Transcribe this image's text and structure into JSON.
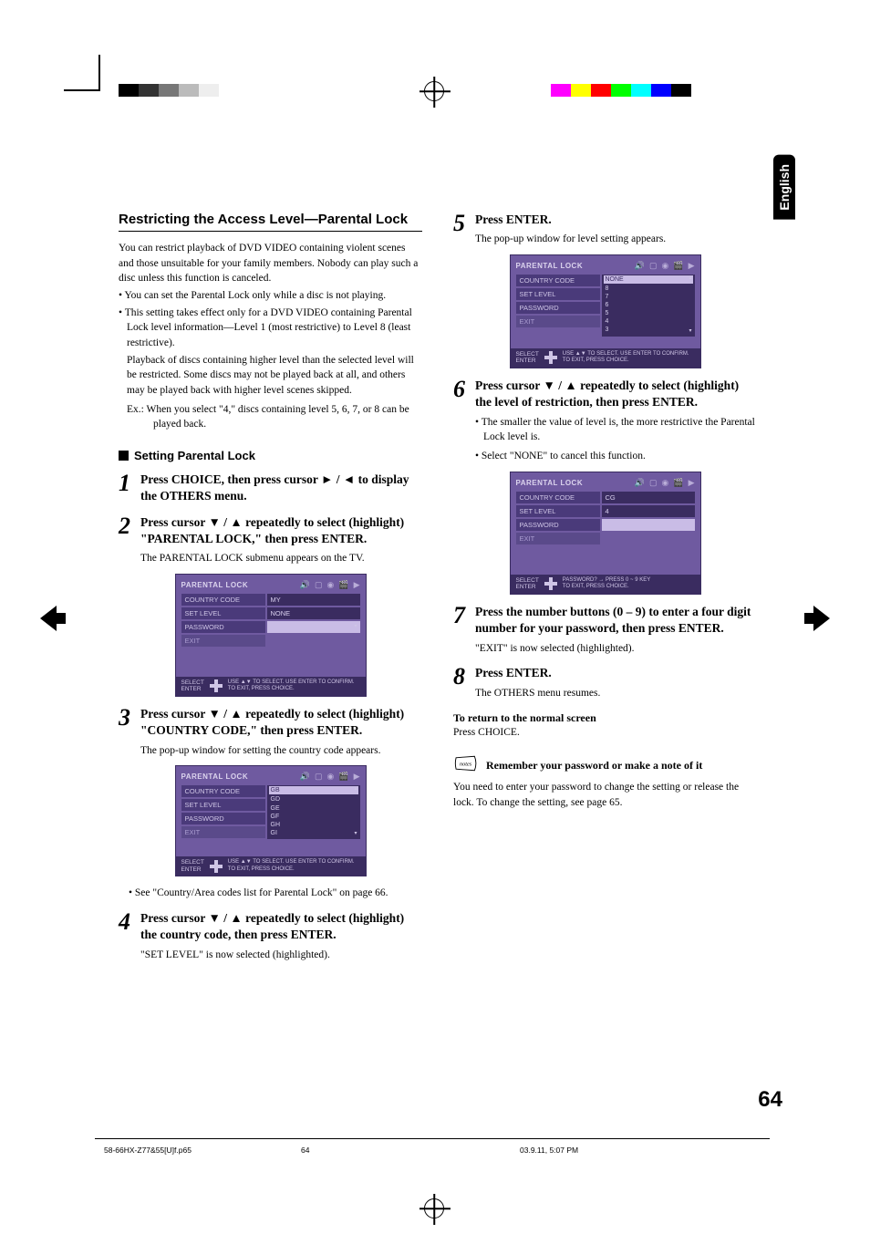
{
  "lang_tab": "English",
  "page_number": "64",
  "footer": {
    "file": "58-66HX-Z77&55[U]f.p65",
    "page": "64",
    "timestamp": "03.9.11, 5:07 PM"
  },
  "left": {
    "section_title": "Restricting the Access Level—Parental Lock",
    "intro": "You can restrict playback of DVD VIDEO containing violent scenes and those unsuitable for your family members. Nobody can play such a disc unless this function is canceled.",
    "b1": "• You can set the Parental Lock only while a disc is not playing.",
    "b2": "• This setting takes effect only for a DVD VIDEO containing Parental Lock level information—Level 1 (most restrictive) to Level 8 (least restrictive).",
    "b2a": "Playback of discs containing higher level than the selected level will be restricted. Some discs may not be played back at all, and others may be played back with higher level scenes skipped.",
    "ex": "Ex.: When you select \"4,\" discs containing level 5, 6, 7, or 8 can be played back.",
    "subhead": "Setting Parental Lock",
    "step1": "Press CHOICE, then press cursor ► / ◄ to display the OTHERS menu.",
    "step2": "Press cursor ▼ / ▲ repeatedly to select (highlight) \"PARENTAL LOCK,\" then press ENTER.",
    "step2_desc": "The PARENTAL LOCK submenu appears on the TV.",
    "step3": "Press cursor ▼ / ▲ repeatedly to select (highlight) \"COUNTRY CODE,\" then press ENTER.",
    "step3_desc": "The pop-up window for setting the country code appears.",
    "step3_note": "• See \"Country/Area codes list for Parental Lock\" on page 66.",
    "step4": "Press cursor ▼ / ▲ repeatedly to select (highlight) the country code, then press ENTER.",
    "step4_desc": "\"SET LEVEL\" is now selected (highlighted).",
    "osd1": {
      "title": "PARENTAL LOCK",
      "rows": {
        "country_code": "COUNTRY CODE",
        "country_code_val": "MY",
        "set_level": "SET LEVEL",
        "set_level_val": "NONE",
        "password": "PASSWORD",
        "exit": "EXIT"
      },
      "footer_lbl1": "SELECT",
      "footer_lbl2": "ENTER",
      "footer_hint": "USE ▲▼ TO SELECT.  USE ENTER TO CONFIRM.\nTO EXIT, PRESS CHOICE."
    },
    "osd2": {
      "title": "PARENTAL LOCK",
      "list": [
        "GB",
        "GD",
        "GE",
        "GF",
        "GH",
        "GI"
      ],
      "footer_lbl1": "SELECT",
      "footer_lbl2": "ENTER",
      "footer_hint": "USE ▲▼ TO SELECT.  USE ENTER TO CONFIRM.\nTO EXIT, PRESS CHOICE."
    }
  },
  "right": {
    "step5": "Press ENTER.",
    "step5_desc": "The pop-up window for level setting appears.",
    "osd3": {
      "title": "PARENTAL LOCK",
      "list": [
        "NONE",
        "8",
        "7",
        "6",
        "5",
        "4",
        "3"
      ],
      "footer_lbl1": "SELECT",
      "footer_lbl2": "ENTER",
      "footer_hint": "USE ▲▼ TO SELECT.  USE ENTER TO CONFIRM.\nTO EXIT, PRESS CHOICE."
    },
    "step6": "Press cursor ▼ / ▲ repeatedly to select (highlight) the level of restriction, then press ENTER.",
    "step6_b1": "• The smaller the value of level is, the more restrictive the Parental Lock level is.",
    "step6_b2": "• Select \"NONE\" to cancel this function.",
    "osd4": {
      "title": "PARENTAL LOCK",
      "country_code_val": "CG",
      "set_level_val": "4",
      "footer_lbl1": "SELECT",
      "footer_lbl2": "ENTER",
      "footer_hint": "PASSWORD? →  PRESS 0 ~ 9 KEY\nTO EXIT, PRESS CHOICE."
    },
    "step7": "Press the number buttons (0 – 9) to enter a four digit number for your password, then press ENTER.",
    "step7_desc": "\"EXIT\" is now selected (highlighted).",
    "step8": "Press ENTER.",
    "step8_desc": "The OTHERS menu resumes.",
    "return_head": "To return to the normal screen",
    "return_body": "Press CHOICE.",
    "notes_title": "Remember your password or make a note of it",
    "notes_body": "You need to enter your password to change the setting or release the lock. To change the setting, see page 65."
  },
  "osd_common": {
    "country_code": "COUNTRY CODE",
    "set_level": "SET LEVEL",
    "password": "PASSWORD",
    "exit": "EXIT"
  }
}
